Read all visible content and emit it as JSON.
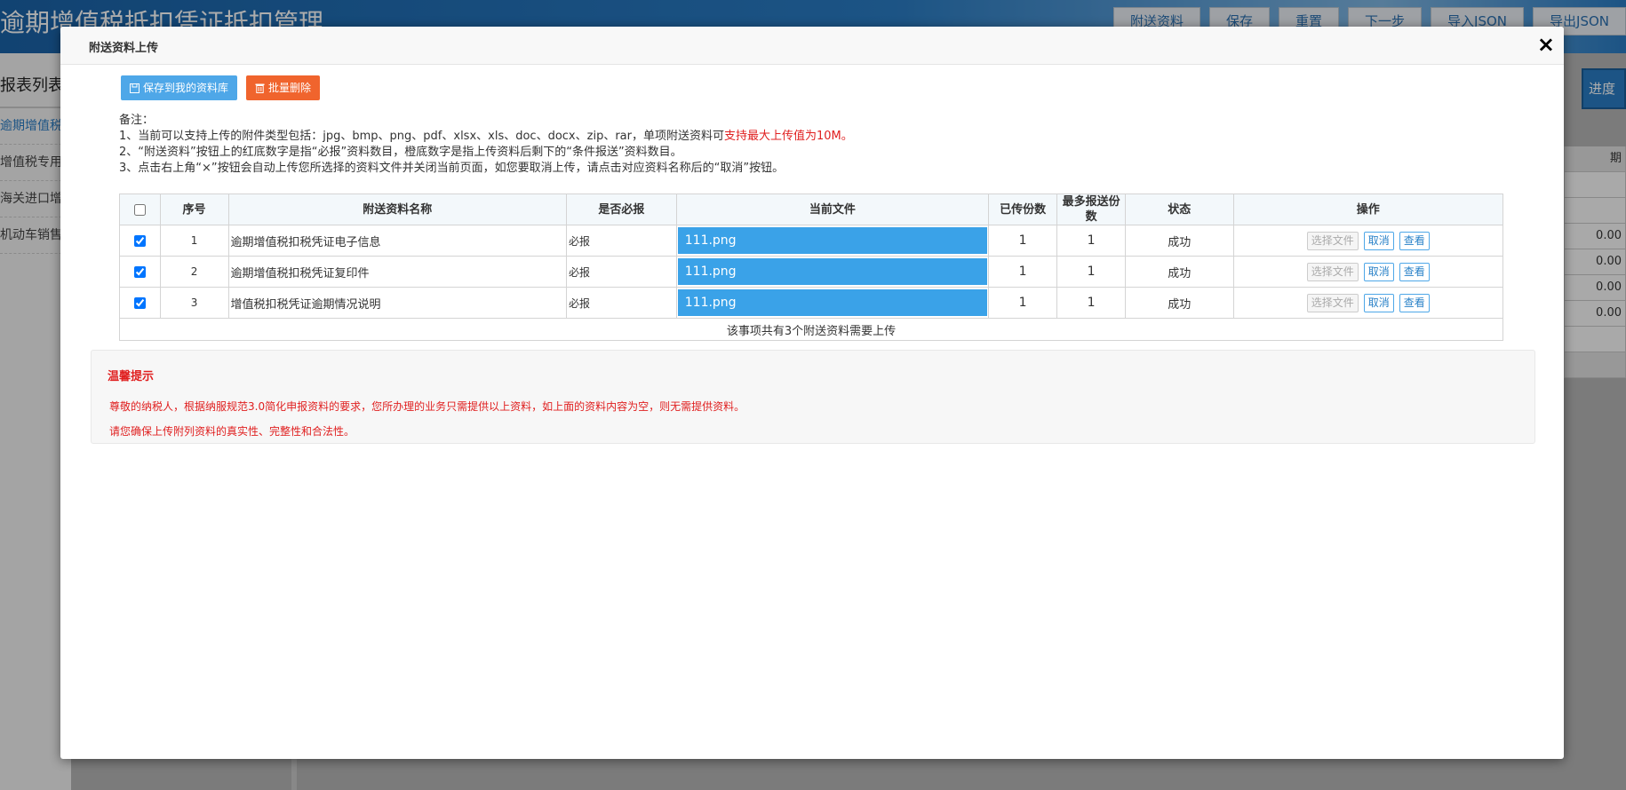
{
  "background": {
    "title": "逾期增值税抵扣凭证抵扣管理",
    "toolbar": [
      "附送资料",
      "保存",
      "重置",
      "下一步",
      "导入JSON",
      "导出JSON"
    ],
    "sidebar": {
      "heading": "报表列表",
      "items": [
        "逾期增值税",
        "增值税专用",
        "海关进口增",
        "机动车销售"
      ]
    },
    "progress_label": "进度",
    "right_table": {
      "head": "期",
      "values": [
        "0.00",
        "0.00",
        "0.00",
        "0.00"
      ]
    }
  },
  "modal": {
    "title": "附送资料上传",
    "close_glyph": "×",
    "buttons": {
      "save_to_library": "保存到我的资料库",
      "batch_delete": "批量删除"
    },
    "notes": {
      "heading": "备注：",
      "line1_a": "1、当前可以支持上传的附件类型包括：jpg、bmp、png、pdf、xlsx、xls、doc、docx、zip、rar，单项附送资料可",
      "line1_b": "支持最大上传值为10M。",
      "line2": "2、“附送资料”按钮上的红底数字是指“必报”资料数目，橙底数字是指上传资料后剩下的“条件报送”资料数目。",
      "line3": "3、点击右上角“×”按钮会自动上传您所选择的资料文件并关闭当前页面，如您要取消上传，请点击对应资料名称后的“取消”按钮。"
    },
    "table": {
      "headers": {
        "index": "序号",
        "name": "附送资料名称",
        "required": "是否必报",
        "current_file": "当前文件",
        "uploaded": "已传份数",
        "max": "最多报送份数",
        "status": "状态",
        "ops": "操作"
      },
      "rows": [
        {
          "index": "1",
          "name": "逾期增值税扣税凭证电子信息",
          "required": "必报",
          "file": "111.png",
          "uploaded": "1",
          "max": "1",
          "status": "成功"
        },
        {
          "index": "2",
          "name": "逾期增值税扣税凭证复印件",
          "required": "必报",
          "file": "111.png",
          "uploaded": "1",
          "max": "1",
          "status": "成功"
        },
        {
          "index": "3",
          "name": "增值税扣税凭证逾期情况说明",
          "required": "必报",
          "file": "111.png",
          "uploaded": "1",
          "max": "1",
          "status": "成功"
        }
      ],
      "op_labels": {
        "choose": "选择文件",
        "cancel": "取消",
        "view": "查看"
      },
      "footer": "该事项共有3个附送资料需要上传"
    },
    "tips": {
      "title": "温馨提示",
      "line1": "尊敬的纳税人，根据纳服规范3.0简化申报资料的要求，您所办理的业务只需提供以上资料，如上面的资料内容为空，则无需提供资料。",
      "line2": "请您确保上传附列资料的真实性、完整性和合法性。"
    }
  }
}
